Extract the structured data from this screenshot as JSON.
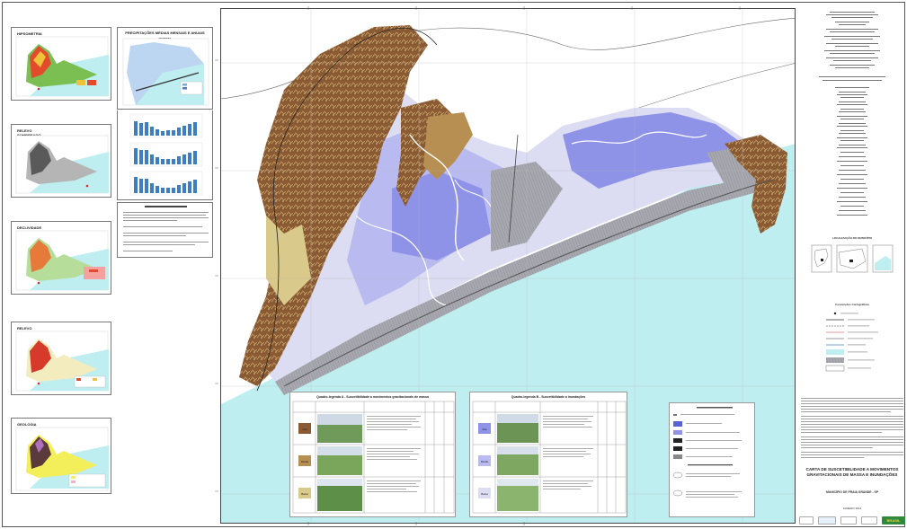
{
  "thumbnails": [
    {
      "title": "HIPSOMETRIA",
      "key": "hipsometria"
    },
    {
      "title": "RELEVO\nSOMBREADO",
      "key": "relevo-sombreado"
    },
    {
      "title": "DECLIVIDADE",
      "key": "declividade"
    },
    {
      "title": "RELEVO",
      "key": "relevo"
    },
    {
      "title": "GEOLOGIA",
      "key": "geologia"
    }
  ],
  "precip": {
    "title": "PRECIPITAÇÕES MÉDIAS MENSAIS E ANUAIS",
    "isoietas_label": "ISOIETAS"
  },
  "location_heading": "LOCALIZAÇÃO DO MUNICÍPIO",
  "table_a": {
    "title": "Quadro-legenda A - Suscetibilidade a movimentos gravitacionais de massa",
    "classes": [
      "Alta",
      "Média",
      "Baixa"
    ]
  },
  "table_b": {
    "title": "Quadro-legenda B - Suscetibilidade a inundações",
    "classes": [
      "Alta",
      "Média",
      "Baixa"
    ]
  },
  "conventions": {
    "title": "Convenções Cartográficas"
  },
  "right": {
    "title": "CARTA DE SUSCETIBILIDADE A MOVIMENTOS GRAVITACIONAIS DE MASSA E INUNDAÇÕES",
    "subtitle": "MUNICÍPIO DE PRAIA GRANDE - SP",
    "date": "JANEIRO 2014",
    "logo_right": "BRASIL"
  },
  "colors": {
    "sea": "#bfeef0",
    "high_relief": "#8a5a34",
    "mid_relief": "#b78f52",
    "low_relief": "#d9c98a",
    "flood_high": "#8f93e8",
    "flood_mid": "#b8baf0",
    "flood_low": "#dcdcf2",
    "urban": "#a9a9b1",
    "river": "#ffffff"
  }
}
